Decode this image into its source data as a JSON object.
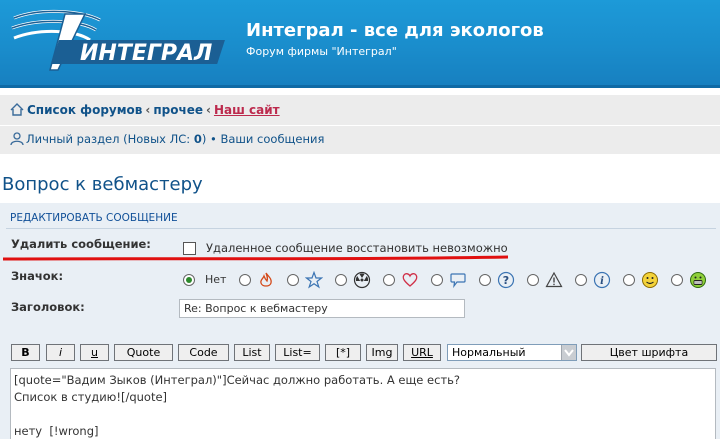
{
  "header": {
    "title": "Интеграл - все для экологов",
    "description": "Форум фирмы \"Интеграл\"",
    "logo_text": "ИНТЕГРАЛ",
    "bg_color": "#1a8dcc"
  },
  "nav": {
    "crumbs": [
      "Список форумов",
      "прочее",
      "Наш сайт"
    ],
    "user_link": "Личный раздел",
    "pm_prefix": "(Новых ЛС: ",
    "pm_count": "0",
    "pm_suffix": ")",
    "bullet": "•",
    "messages_link": "Ваши сообщения"
  },
  "page": {
    "title": "Вопрос к вебмастеру"
  },
  "form": {
    "heading": "РЕДАКТИРОВАТЬ СООБЩЕНИЕ",
    "delete_label": "Удалить сообщение:",
    "delete_checked": false,
    "delete_note": "Удаленное сообщение восстановить невозможно",
    "icon_label": "Значок:",
    "icon_options": [
      {
        "name": "none",
        "label": "Нет",
        "checked": true
      },
      {
        "name": "fire-icon"
      },
      {
        "name": "star-icon"
      },
      {
        "name": "radioactive-icon"
      },
      {
        "name": "heart-icon"
      },
      {
        "name": "comment-bubble-icon"
      },
      {
        "name": "question-icon"
      },
      {
        "name": "warning-icon"
      },
      {
        "name": "info-icon"
      },
      {
        "name": "smile-icon"
      },
      {
        "name": "grin-icon"
      }
    ],
    "subject_label": "Заголовок:",
    "subject_value": "Re: Вопрос к вебмастеру"
  },
  "toolbar": {
    "bold": "B",
    "italic": "i",
    "underline": "u",
    "quote": "Quote",
    "code": "Code",
    "list": "List",
    "list_eq": "List=",
    "list_item": "[*]",
    "img": "Img",
    "url": "URL",
    "font_size": "Нормальный",
    "font_color": "Цвет шрифта"
  },
  "message": {
    "text": "[quote=\"Вадим Зыков (Интеграл)\"]Сейчас должно работать. А еще есть?\nСписок в студию![/quote]\n\nнету  [!wrong]"
  }
}
